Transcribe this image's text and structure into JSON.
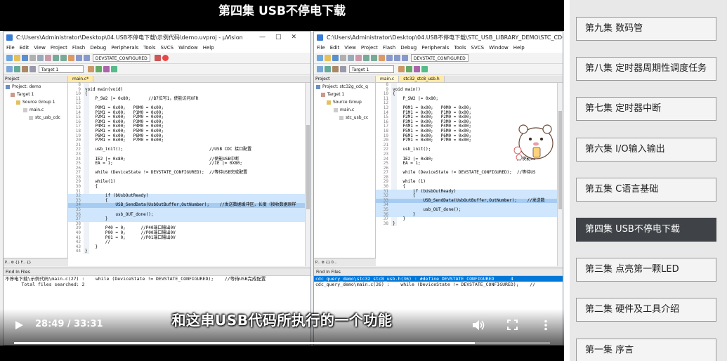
{
  "video": {
    "title": "第四集 USB不停电下载",
    "subtitle": "和这串USB代码所执行的一个功能",
    "time_display": "28:49 / 33:31",
    "progress": 0.86
  },
  "icons": {
    "play": "play-icon",
    "volume": "volume-icon",
    "fullscreen": "fullscreen-icon",
    "more": "more-vertical-icon"
  },
  "left_window": {
    "title": "C:\\Users\\Administrator\\Desktop\\04.USB不停电下载\\示例代码\\demo.uvproj - µVision",
    "menu": [
      "File",
      "Edit",
      "View",
      "Project",
      "Flash",
      "Debug",
      "Peripherals",
      "Tools",
      "SVCS",
      "Window",
      "Help"
    ],
    "toolbar_combo": "DEVSTATE_CONFIGURED",
    "target_combo": "Target 1",
    "project_header": "Project",
    "tree": [
      "Project: demo",
      "Target 1",
      "Source Group 1",
      "main.c",
      "stc_usb_cdc"
    ],
    "project_tabs": "P... ⚙ {} F... {}",
    "tabs": [
      "main.c*"
    ],
    "code": [
      {
        "n": "8",
        "t": ""
      },
      {
        "n": "9",
        "t": "void main(void)"
      },
      {
        "n": "10",
        "t": "{"
      },
      {
        "n": "11",
        "t": "    P_SW2 |= 0x80;       //B7位写1，使能访问XFR"
      },
      {
        "n": "12",
        "t": ""
      },
      {
        "n": "13",
        "t": "    P0M1 = 0x00;   P0M0 = 0x00;"
      },
      {
        "n": "14",
        "t": "    P1M1 = 0x00;   P1M0 = 0x00;"
      },
      {
        "n": "15",
        "t": "    P2M1 = 0x00;   P2M0 = 0x00;"
      },
      {
        "n": "16",
        "t": "    P3M1 = 0x00;   P3M0 = 0x00;"
      },
      {
        "n": "17",
        "t": "    P4M1 = 0x00;   P4M0 = 0x00;"
      },
      {
        "n": "18",
        "t": "    P5M1 = 0x00;   P5M0 = 0x00;"
      },
      {
        "n": "19",
        "t": "    P6M1 = 0x00;   P6M0 = 0x00;"
      },
      {
        "n": "20",
        "t": "    P7M1 = 0x00;   P7M0 = 0x00;"
      },
      {
        "n": "21",
        "t": ""
      },
      {
        "n": "22",
        "t": "    usb_init();                                  //USB CDC 接口配置"
      },
      {
        "n": "23",
        "t": ""
      },
      {
        "n": "24",
        "t": "    IE2 |= 0x80;                                 //使能USB中断"
      },
      {
        "n": "25",
        "t": "    EA = 1;                                      //IE |= 0X80;"
      },
      {
        "n": "26",
        "t": ""
      },
      {
        "n": "27",
        "t": "    while (DeviceState != DEVSTATE_CONFIGURED);  //等待USB完成配置"
      },
      {
        "n": "28",
        "t": ""
      },
      {
        "n": "29",
        "t": "    while(1)"
      },
      {
        "n": "30",
        "t": "    {"
      },
      {
        "n": "31",
        "t": ""
      },
      {
        "n": "32",
        "t": "        if (bUsbOutReady)"
      },
      {
        "n": "33",
        "t": "        {"
      },
      {
        "n": "34",
        "t": "            USB_SendData(UsbOutBuffer,OutNumber);    //发送数据缓冲区，长度（接收数据原样"
      },
      {
        "n": "35",
        "t": ""
      },
      {
        "n": "36",
        "t": "            usb_OUT_done();"
      },
      {
        "n": "37",
        "t": "        }"
      },
      {
        "n": "38",
        "t": ""
      },
      {
        "n": "39",
        "t": "        P40 = 0;      //P40端口输出0V"
      },
      {
        "n": "40",
        "t": "        P00 = 0;      //P00端口输出0V"
      },
      {
        "n": "41",
        "t": "        P01 = 0;      //P01端口输出0V"
      },
      {
        "n": "42",
        "t": "        //"
      },
      {
        "n": "43",
        "t": "    }"
      },
      {
        "n": "44",
        "t": "}"
      }
    ],
    "find_header": "Find In Files",
    "find_lines": [
      "不停电下载\\示例代码\\main.c(27) :    while (DeviceState != DEVSTATE_CONFIGURED);    //等待USB完成配置",
      "      Total files searched: 2"
    ]
  },
  "right_window": {
    "title": "C:\\Users\\Administrator\\Desktop\\04.USB不停电下载\\STC_USB_LIBRARY_DEMO\\STC_CDC...",
    "menu": [
      "File",
      "Edit",
      "View",
      "Project",
      "Flash",
      "Debug",
      "Peripherals",
      "Tools",
      "SVCS",
      "Window",
      "Help"
    ],
    "toolbar_combo": "DEVSTATE_CONFIGURED",
    "target_combo": "Target 1",
    "project_header": "Project",
    "tree": [
      "Project: stc32g_cdc_q",
      "Target 1",
      "Source Group",
      "main.c",
      "stc_usb_cc"
    ],
    "project_tabs": "P... ⚙ {} 0... ",
    "tabs": [
      "main.c",
      "stc32_stc8_usb.h"
    ],
    "code": [
      {
        "n": "8",
        "t": ""
      },
      {
        "n": "9",
        "t": "void main()"
      },
      {
        "n": "10",
        "t": "{"
      },
      {
        "n": "11",
        "t": "    P_SW2 |= 0x80;"
      },
      {
        "n": "12",
        "t": ""
      },
      {
        "n": "13",
        "t": "    P0M1 = 0x00;   P0M0 = 0x00;"
      },
      {
        "n": "14",
        "t": "    P1M1 = 0x00;   P1M0 = 0x00;"
      },
      {
        "n": "15",
        "t": "    P2M1 = 0x00;   P2M0 = 0x00;"
      },
      {
        "n": "16",
        "t": "    P3M1 = 0x00;   P3M0 = 0x00;"
      },
      {
        "n": "17",
        "t": "    P4M1 = 0x00;   P4M0 = 0x00;"
      },
      {
        "n": "18",
        "t": "    P5M1 = 0x00;   P5M0 = 0x00;"
      },
      {
        "n": "19",
        "t": "    P6M1 = 0x00;   P6M0 = 0x00;"
      },
      {
        "n": "20",
        "t": "    P7M1 = 0x00;   P7M0 = 0x00;"
      },
      {
        "n": "21",
        "t": ""
      },
      {
        "n": "22",
        "t": "    usb_init();                                  //USB CD"
      },
      {
        "n": "23",
        "t": ""
      },
      {
        "n": "24",
        "t": "    IE2 |= 0x80;                                 //使能US"
      },
      {
        "n": "25",
        "t": "    EA = 1;"
      },
      {
        "n": "26",
        "t": ""
      },
      {
        "n": "27",
        "t": "    while (DeviceState != DEVSTATE_CONFIGURED);  //等待US"
      },
      {
        "n": "28",
        "t": ""
      },
      {
        "n": "29",
        "t": "    while (1)"
      },
      {
        "n": "30",
        "t": "    {"
      },
      {
        "n": "31",
        "t": "        if (bUsbOutReady)"
      },
      {
        "n": "32",
        "t": "        {"
      },
      {
        "n": "33",
        "t": "            USB_SendData(UsbOutBuffer,OutNumber);    //发送数"
      },
      {
        "n": "34",
        "t": ""
      },
      {
        "n": "35",
        "t": "            usb_OUT_done();"
      },
      {
        "n": "36",
        "t": "        }"
      },
      {
        "n": "37",
        "t": "    }"
      },
      {
        "n": "38",
        "t": "}"
      }
    ],
    "find_header": "Find In Files",
    "find_lines": [
      "cdc_query_demo\\stc32_stc8_usb.h(36) : #define DEVSTATE_CONFIGURED      4",
      "cdc_query_demo\\main.c(26) :    while (DeviceState != DEVSTATE_CONFIGURED);    //"
    ]
  },
  "playlist": {
    "episodes": [
      {
        "label": "第九集 数码管",
        "active": false
      },
      {
        "label": "第八集 定时器周期性调度任务",
        "active": false
      },
      {
        "label": "第七集 定时器中断",
        "active": false
      },
      {
        "label": "第六集 I/O输入输出",
        "active": false
      },
      {
        "label": "第五集 C语言基础",
        "active": false
      },
      {
        "label": "第四集 USB不停电下载",
        "active": true
      },
      {
        "label": "第三集 点亮第一颗LED",
        "active": false
      },
      {
        "label": "第二集 硬件及工具介绍",
        "active": false
      },
      {
        "label": "第一集 序言",
        "active": false
      }
    ]
  },
  "colors": {
    "active_episode": "#3f4247",
    "code_highlight": "#cfe6fc",
    "find_selection": "#0078d7"
  }
}
